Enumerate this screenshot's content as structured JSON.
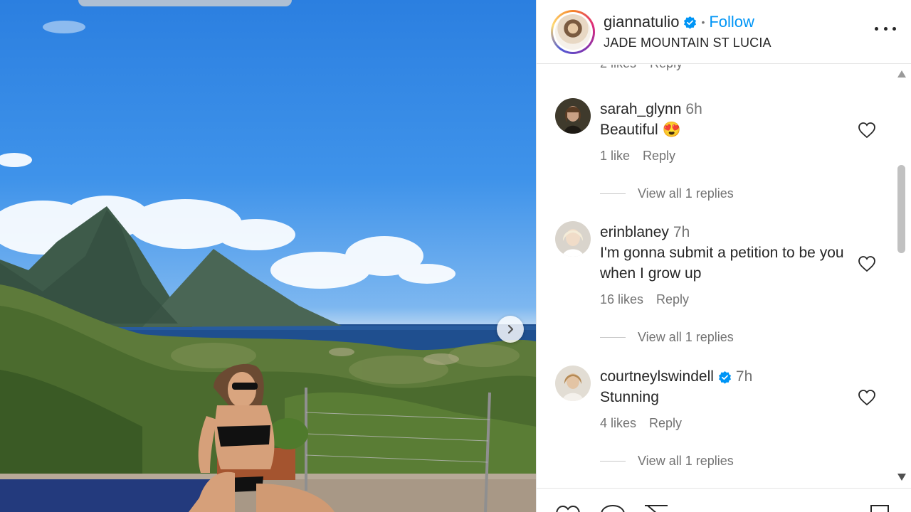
{
  "post": {
    "username": "giannatulio",
    "follow_label": "Follow",
    "location": "JADE MOUNTAIN ST LUCIA"
  },
  "partial_comment": {
    "likes": "2 likes",
    "reply": "Reply"
  },
  "comments": [
    {
      "user": "sarah_glynn",
      "time": "6h",
      "text": "Beautiful 😍",
      "likes": "1 like",
      "reply": "Reply",
      "view_replies": "View all 1 replies",
      "verified": false
    },
    {
      "user": "erinblaney",
      "time": "7h",
      "text": "I'm gonna submit a petition to be you when I grow up",
      "likes": "16 likes",
      "reply": "Reply",
      "view_replies": "View all 1 replies",
      "verified": false
    },
    {
      "user": "courtneylswindell",
      "time": "7h",
      "text": "Stunning",
      "likes": "4 likes",
      "reply": "Reply",
      "view_replies": "View all 1 replies",
      "verified": true
    }
  ],
  "icons": [
    "next-arrow-icon",
    "verified-icon",
    "more-options-icon",
    "heart-icon",
    "comment-icon",
    "share-icon",
    "save-icon",
    "scroll-up-icon",
    "scroll-down-icon"
  ],
  "colors": {
    "accent": "#0095f6",
    "text": "#262626",
    "muted": "#737373"
  }
}
